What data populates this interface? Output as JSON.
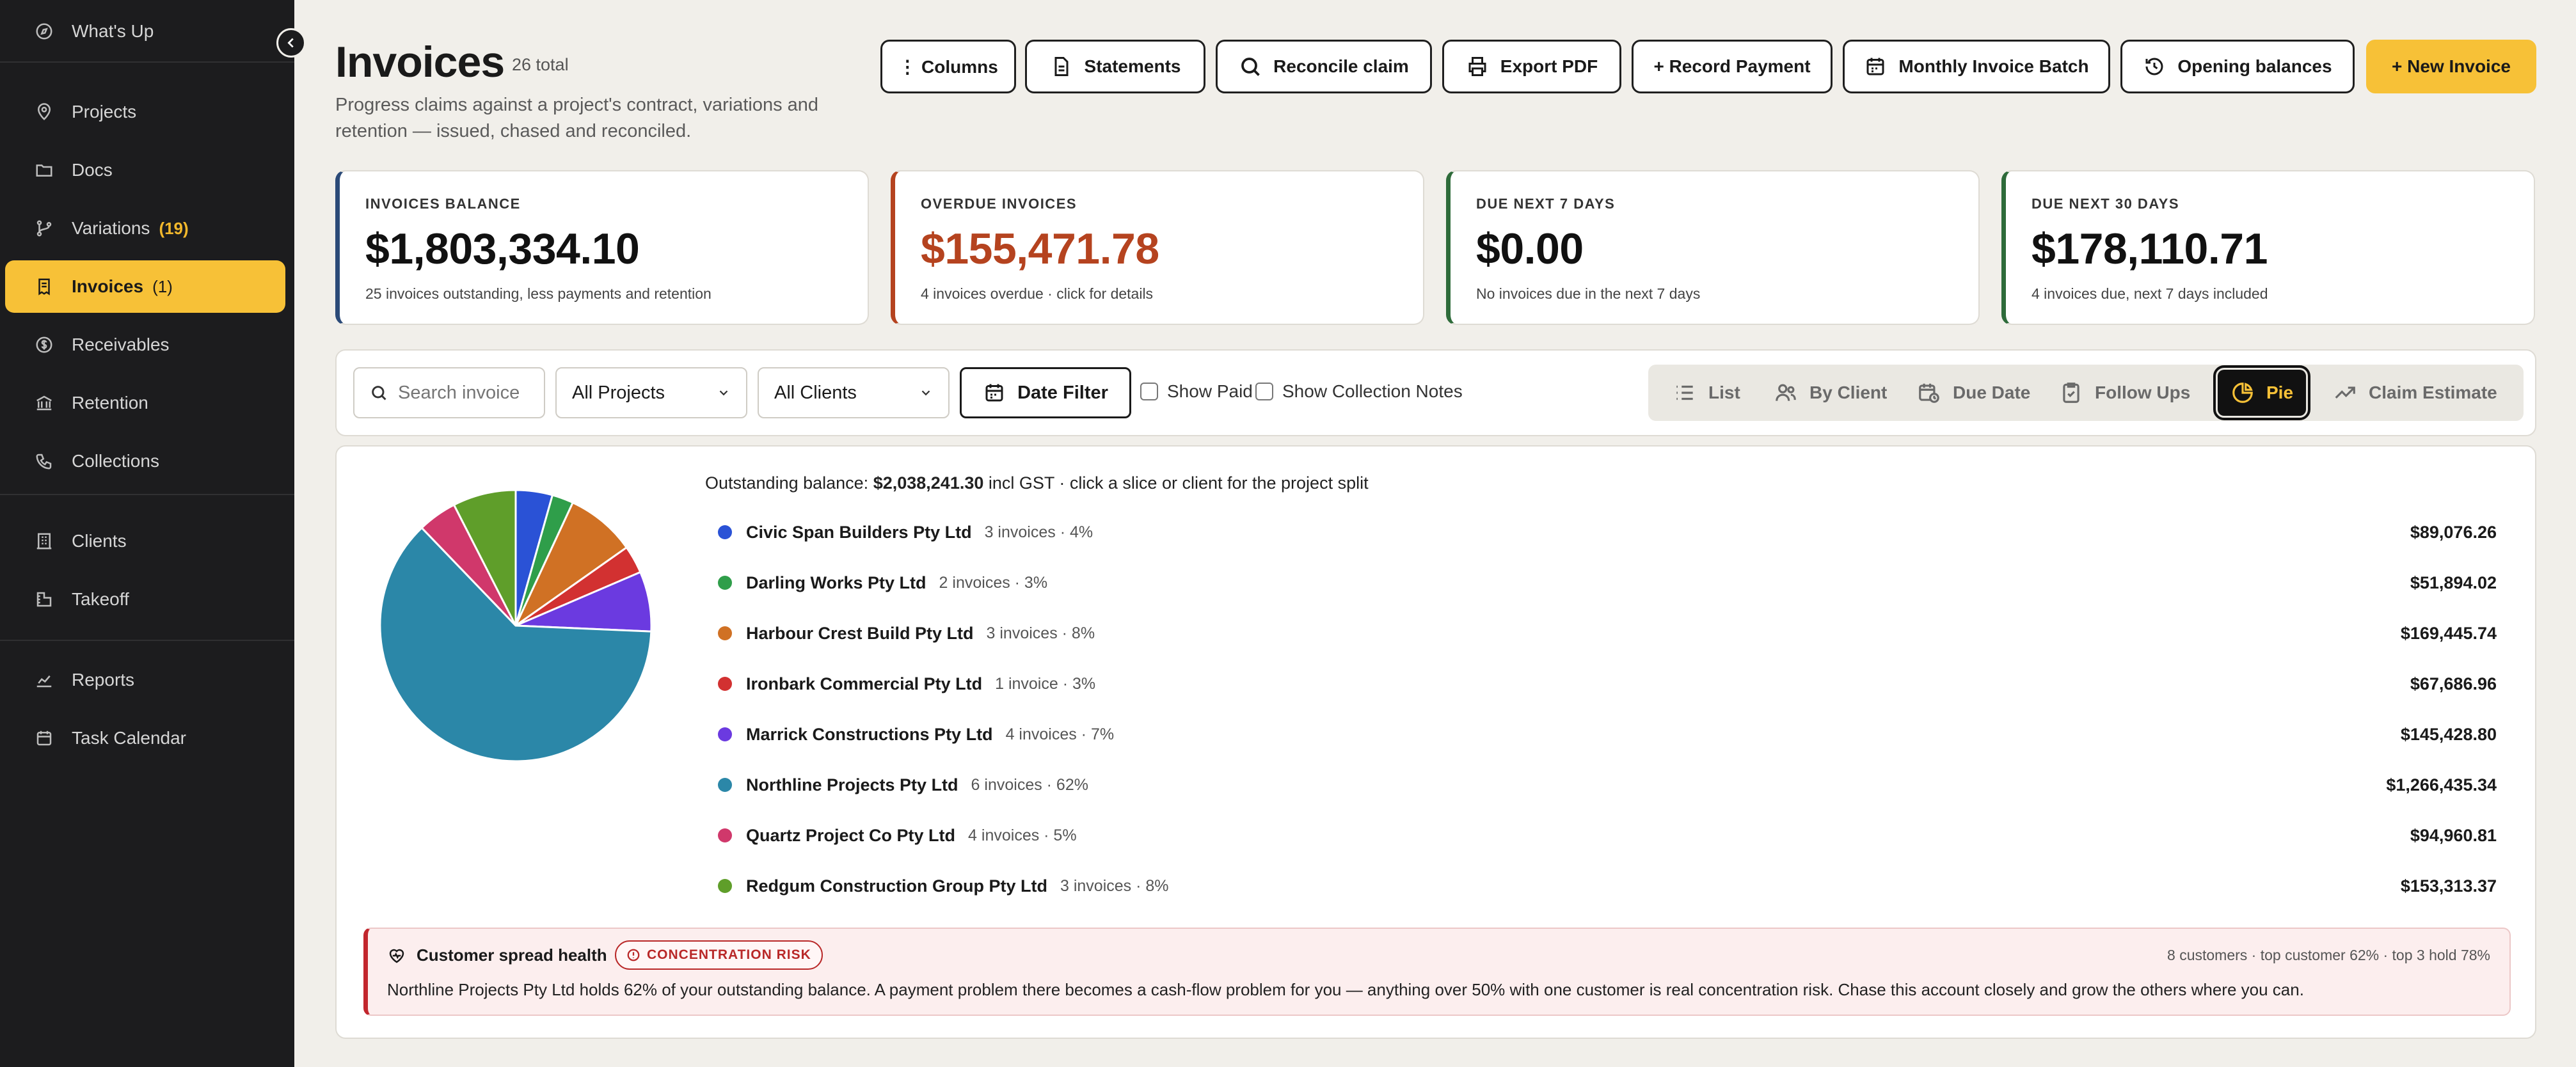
{
  "sidebar": {
    "items": [
      {
        "label": "What's Up",
        "count": "",
        "icon": "compass-icon"
      },
      {
        "label": "Projects",
        "count": "",
        "icon": "pin-icon"
      },
      {
        "label": "Docs",
        "count": "",
        "icon": "folder-icon"
      },
      {
        "label": "Variations",
        "count": "(19)",
        "icon": "branch-icon"
      },
      {
        "label": "Invoices",
        "count": "(1)",
        "icon": "receipt-icon"
      },
      {
        "label": "Receivables",
        "count": "",
        "icon": "dollar-icon"
      },
      {
        "label": "Retention",
        "count": "",
        "icon": "bank-icon"
      },
      {
        "label": "Collections",
        "count": "",
        "icon": "phone-icon"
      },
      {
        "label": "Clients",
        "count": "",
        "icon": "building-icon"
      },
      {
        "label": "Takeoff",
        "count": "",
        "icon": "ruler-icon"
      },
      {
        "label": "Reports",
        "count": "",
        "icon": "chart-icon"
      },
      {
        "label": "Task Calendar",
        "count": "",
        "icon": "calendar-icon"
      }
    ]
  },
  "header": {
    "title": "Invoices",
    "total": "26 total",
    "subtitle": "Progress claims against a project's contract, variations and retention — issued, chased and reconciled."
  },
  "toolbar": {
    "columns": "⋮ Columns",
    "statements": "Statements",
    "reconcile": "Reconcile claim",
    "export_pdf": "Export PDF",
    "record_payment": "+ Record Payment",
    "monthly_batch": "Monthly Invoice Batch",
    "opening_balances": "Opening balances",
    "new_invoice": "+ New Invoice"
  },
  "cards": [
    {
      "label": "INVOICES BALANCE",
      "value": "$1,803,334.10",
      "sub": "25 invoices outstanding, less payments and retention",
      "accent": "#2b4a78",
      "value_color": "#111111"
    },
    {
      "label": "OVERDUE INVOICES",
      "value": "$155,471.78",
      "sub": "4 invoices overdue · click for details",
      "accent": "#b5431f",
      "value_color": "#b5431f"
    },
    {
      "label": "DUE NEXT 7 DAYS",
      "value": "$0.00",
      "sub": "No invoices due in the next 7 days",
      "accent": "#2e6b3a",
      "value_color": "#111111"
    },
    {
      "label": "DUE NEXT 30 DAYS",
      "value": "$178,110.71",
      "sub": "4 invoices due, next 7 days included",
      "accent": "#2e6b3a",
      "value_color": "#111111"
    }
  ],
  "filters": {
    "search_placeholder": "Search invoices",
    "project": "All Projects",
    "client": "All Clients",
    "date_filter": "Date Filter",
    "show_paid": "Show Paid",
    "show_notes": "Show Collection Notes"
  },
  "views": [
    {
      "label": "List",
      "icon": "list-icon",
      "active": false
    },
    {
      "label": "By Client",
      "icon": "users-icon",
      "active": false
    },
    {
      "label": "Due Date",
      "icon": "calendar-clock-icon",
      "active": false
    },
    {
      "label": "Follow Ups",
      "icon": "clipboard-icon",
      "active": false
    },
    {
      "label": "Pie",
      "icon": "pie-icon",
      "active": true
    },
    {
      "label": "Claim Estimate",
      "icon": "trend-icon",
      "active": false
    }
  ],
  "summary": {
    "prefix": "Outstanding balance:",
    "amount": "$2,038,241.30",
    "suffix": "incl GST · click a slice or client for the project split"
  },
  "chart_data": {
    "type": "pie",
    "categories": [
      "Civic Span Builders Pty Ltd",
      "Darling Works Pty Ltd",
      "Harbour Crest Build Pty Ltd",
      "Ironbark Commercial Pty Ltd",
      "Marrick Constructions Pty Ltd",
      "Northline Projects Pty Ltd",
      "Quartz Project Co Pty Ltd",
      "Redgum Construction Group Pty Ltd"
    ],
    "values": [
      89076.26,
      51894.02,
      169445.74,
      67686.96,
      145428.8,
      1266435.34,
      94960.81,
      153313.37
    ],
    "colors": [
      "#2a52d6",
      "#2f9e4a",
      "#d07124",
      "#d23131",
      "#6b3ae0",
      "#2b87a8",
      "#d0386b",
      "#5f9e2a"
    ]
  },
  "clients": [
    {
      "name": "Civic Span Builders Pty Ltd",
      "meta": "3 invoices · 4%",
      "amount": "$89,076.26"
    },
    {
      "name": "Darling Works Pty Ltd",
      "meta": "2 invoices · 3%",
      "amount": "$51,894.02"
    },
    {
      "name": "Harbour Crest Build Pty Ltd",
      "meta": "3 invoices · 8%",
      "amount": "$169,445.74"
    },
    {
      "name": "Ironbark Commercial Pty Ltd",
      "meta": "1 invoice · 3%",
      "amount": "$67,686.96"
    },
    {
      "name": "Marrick Constructions Pty Ltd",
      "meta": "4 invoices · 7%",
      "amount": "$145,428.80"
    },
    {
      "name": "Northline Projects Pty Ltd",
      "meta": "6 invoices · 62%",
      "amount": "$1,266,435.34"
    },
    {
      "name": "Quartz Project Co Pty Ltd",
      "meta": "4 invoices · 5%",
      "amount": "$94,960.81"
    },
    {
      "name": "Redgum Construction Group Pty Ltd",
      "meta": "3 invoices · 8%",
      "amount": "$153,313.37"
    }
  ],
  "health": {
    "title": "Customer spread health",
    "badge": "CONCENTRATION RISK",
    "stats": "8 customers · top customer 62% · top 3 hold 78%",
    "message": "Northline Projects Pty Ltd holds 62% of your outstanding balance. A payment problem there becomes a cash-flow problem for you — anything over 50% with one customer is real concentration risk. Chase this account closely and grow the others where you can."
  }
}
